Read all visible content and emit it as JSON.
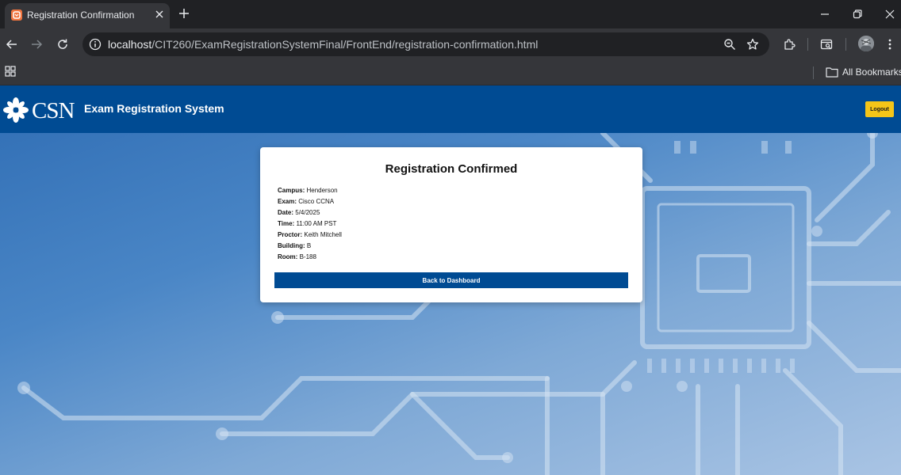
{
  "browser": {
    "tab_title": "Registration Confirmation",
    "url_host": "localhost",
    "url_path": "/CIT260/ExamRegistrationSystemFinal/FrontEnd/registration-confirmation.html",
    "bookmarks_label": "All Bookmarks"
  },
  "header": {
    "logo_text": "CSN",
    "site_title": "Exam Registration System",
    "logout_label": "Logout"
  },
  "confirmation": {
    "title": "Registration Confirmed",
    "details": [
      {
        "label": "Campus:",
        "value": "Henderson"
      },
      {
        "label": "Exam:",
        "value": "Cisco CCNA"
      },
      {
        "label": "Date:",
        "value": "5/4/2025"
      },
      {
        "label": "Time:",
        "value": "11:00 AM PST"
      },
      {
        "label": "Proctor:",
        "value": "Keith Mitchell"
      },
      {
        "label": "Building:",
        "value": "B"
      },
      {
        "label": "Room:",
        "value": "B-188"
      }
    ],
    "back_button_label": "Back to Dashboard"
  },
  "colors": {
    "brand_blue": "#004b93",
    "logout_yellow": "#f5c518"
  },
  "icons": [
    "tab-favicon-icon",
    "close-icon",
    "plus-icon",
    "minimize-icon",
    "restore-icon",
    "back-arrow-icon",
    "forward-arrow-icon",
    "reload-icon",
    "info-icon",
    "zoom-icon",
    "star-icon",
    "extensions-icon",
    "tab-search-icon",
    "avatar-icon",
    "menu-icon",
    "apps-grid-icon",
    "folder-icon",
    "csn-flower-logo-icon"
  ]
}
